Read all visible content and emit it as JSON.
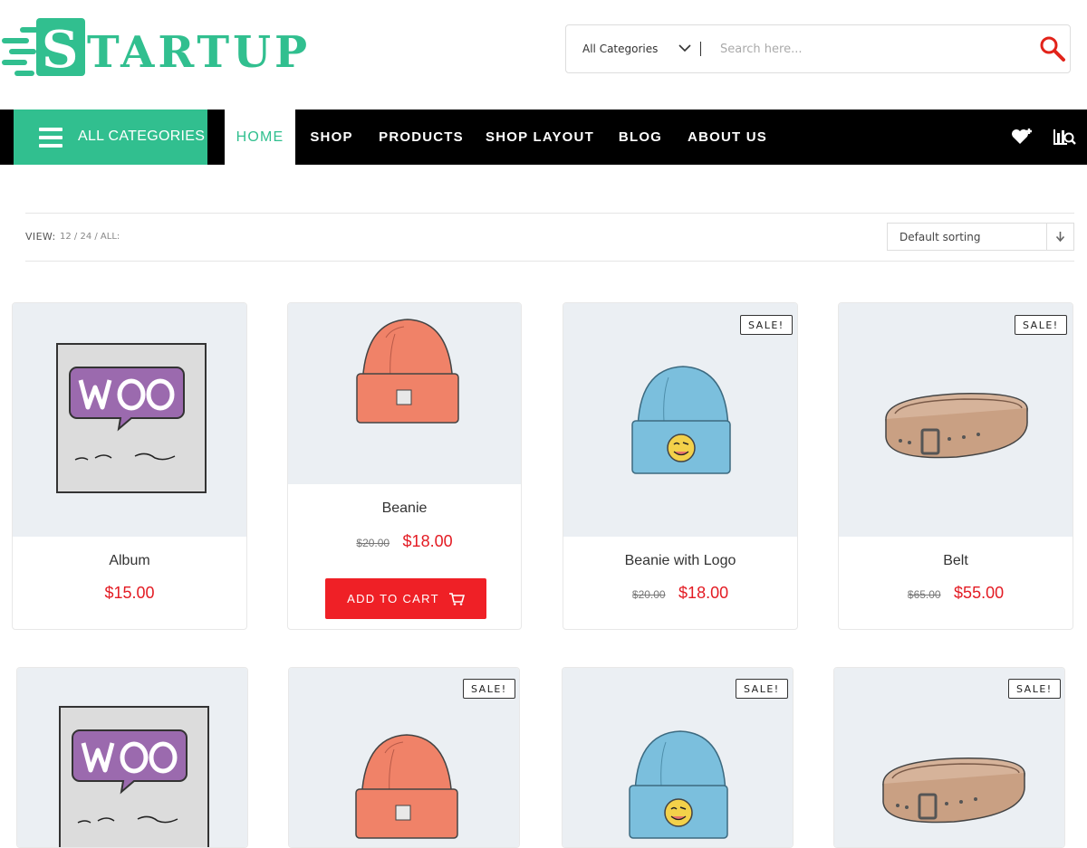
{
  "brand": {
    "name": "STARTUP",
    "accent_color": "#31bf8f",
    "sale_color": "#e31b23"
  },
  "search": {
    "category_selected": "All Categories",
    "placeholder": "Search here..."
  },
  "nav": {
    "all_categories": "ALL CATEGORIES",
    "items": [
      "HOME",
      "SHOP",
      "PRODUCTS",
      "SHOP LAYOUT",
      "BLOG",
      "ABOUT US"
    ],
    "active": "HOME",
    "icons": [
      "wishlist-icon",
      "compare-icon"
    ]
  },
  "toolbar": {
    "view_label": "VIEW:",
    "view_options": "12 / 24 / ALL:",
    "sort_selected": "Default sorting"
  },
  "products": [
    {
      "title": "Album",
      "old_price": "",
      "price": "$15.00",
      "sale": false,
      "image": "album-image"
    },
    {
      "title": "Beanie",
      "old_price": "$20.00",
      "price": "$18.00",
      "sale": false,
      "image": "beanie-image",
      "add_to_cart": "ADD TO CART"
    },
    {
      "title": "Beanie with Logo",
      "old_price": "$20.00",
      "price": "$18.00",
      "sale": true,
      "sale_label": "SALE!",
      "image": "beanie-logo-image"
    },
    {
      "title": "Belt",
      "old_price": "$65.00",
      "price": "$55.00",
      "sale": true,
      "sale_label": "SALE!",
      "image": "belt-image"
    },
    {
      "title": "",
      "sale": false,
      "image": "album-image"
    },
    {
      "title": "",
      "sale": true,
      "sale_label": "SALE!",
      "image": "beanie-image"
    },
    {
      "title": "",
      "sale": true,
      "sale_label": "SALE!",
      "image": "beanie-logo-image"
    },
    {
      "title": "",
      "sale": true,
      "sale_label": "SALE!",
      "image": "belt-image"
    }
  ]
}
